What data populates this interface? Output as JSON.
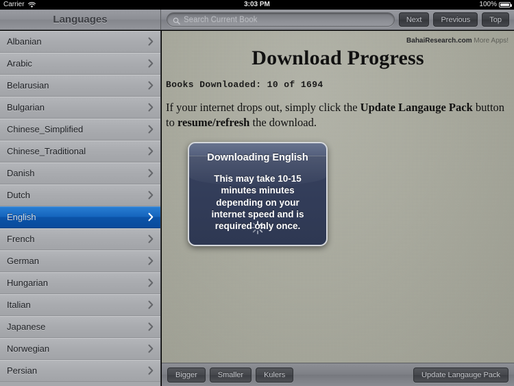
{
  "status_bar": {
    "carrier": "Carrier",
    "wifi_icon": "wifi-icon",
    "time": "3:03 PM",
    "battery_percent": "100%",
    "battery_icon": "battery-icon"
  },
  "navbar": {
    "sidebar_title": "Languages",
    "search": {
      "icon": "search-icon",
      "placeholder": "Search Current Book",
      "value": ""
    },
    "buttons": [
      {
        "label": "Next"
      },
      {
        "label": "Previous"
      },
      {
        "label": "Top"
      }
    ]
  },
  "sidebar": {
    "selected": "English",
    "items": [
      {
        "label": "Albanian"
      },
      {
        "label": "Arabic"
      },
      {
        "label": "Belarusian"
      },
      {
        "label": "Bulgarian"
      },
      {
        "label": "Chinese_Simplified"
      },
      {
        "label": "Chinese_Traditional"
      },
      {
        "label": "Danish"
      },
      {
        "label": "Dutch"
      },
      {
        "label": "English"
      },
      {
        "label": "French"
      },
      {
        "label": "German"
      },
      {
        "label": "Hungarian"
      },
      {
        "label": "Italian"
      },
      {
        "label": "Japanese"
      },
      {
        "label": "Norwegian"
      },
      {
        "label": "Persian"
      }
    ]
  },
  "content": {
    "more_apps": {
      "site": "BahaiResearch.com",
      "apps": " More Apps!"
    },
    "title": "Download Progress",
    "books_downloaded": "Books Downloaded: 10 of 1694",
    "downloaded_count": 10,
    "total_count": 1694,
    "instructions": {
      "part1": "If your internet drops out, simply click the ",
      "bold1": "Update Langauge Pack",
      "part2": " button to ",
      "bold2": "resume/refresh",
      "part3": " the download."
    }
  },
  "modal": {
    "title": "Downloading English",
    "body": "This may take 10-15 minutes minutes depending on your internet speed and is required only once.",
    "spinner_icon": "loading-spinner-icon"
  },
  "bottom_toolbar": {
    "bigger": "Bigger",
    "smaller": "Smaller",
    "kulers": "Kulers",
    "update_pack": "Update Langauge Pack"
  },
  "colors": {
    "selection_blue": "#1565bd",
    "modal_navy": "#36415e",
    "page_background": "#a9aa9e",
    "chrome_gray": "#85878e"
  }
}
